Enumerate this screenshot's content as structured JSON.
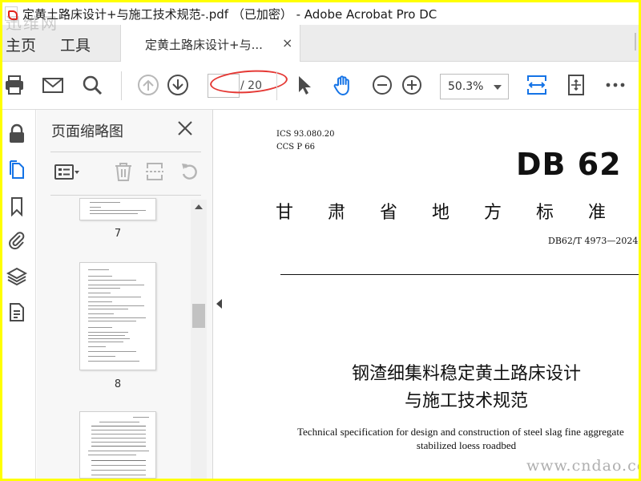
{
  "window": {
    "title": "定黄土路床设计+与施工技术规范-.pdf （已加密） - Adobe Acrobat Pro DC"
  },
  "tabs": {
    "home": "主页",
    "tools": "工具",
    "document": "定黄土路床设计+与...",
    "close": "×"
  },
  "toolbar": {
    "current_page": "",
    "page_total": "/ 20",
    "zoom": "50.3%"
  },
  "panel": {
    "title": "页面缩略图",
    "thumbnails": [
      {
        "label": "7"
      },
      {
        "label": "8"
      }
    ]
  },
  "document": {
    "ics": "ICS  93.080.20",
    "ccs": "CCS  P  66",
    "standard_mark": "DB 62",
    "issuer": "甘肃省地方标准",
    "code": "DB62/T 4973—2024",
    "title_line1": "钢渣细集料稳定黄土路床设计",
    "title_line2": "与施工技术规范",
    "en_line1": "Technical specification for design and construction of steel slag fine aggregate",
    "en_line2": "stabilized loess roadbed"
  },
  "watermarks": {
    "top_left": "迅维网",
    "bottom_right": "www.cndao.com"
  },
  "colors": {
    "frame": "#ffff00",
    "accent_blue": "#1473e6",
    "highlight_oval": "#e53935"
  }
}
